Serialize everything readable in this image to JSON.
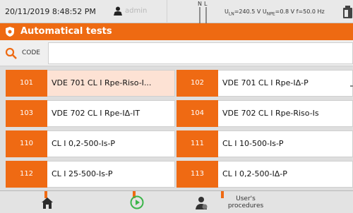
{
  "status": {
    "datetime": "20/11/2019 8:48:52 PM",
    "user": "admin",
    "n_label": "N",
    "l_label": "L",
    "uln_label": "U",
    "uln_sub": "LN",
    "uln_value": "=240.5 V",
    "upe_label": "U",
    "upe_sub": "NPE",
    "upe_value": "=0.8 V",
    "freq": "f=50.0 Hz"
  },
  "header": {
    "title": "Automatical tests"
  },
  "search": {
    "label": "CODE",
    "value": ""
  },
  "procedures": [
    {
      "num": "101",
      "name": "VDE 701 CL I Rpe-Riso-I...",
      "selected": true
    },
    {
      "num": "102",
      "name": "VDE 701 CL I Rpe-IΔ-P"
    },
    {
      "num": "103",
      "name": "VDE 702 CL I Rpe-IΔ-IT"
    },
    {
      "num": "104",
      "name": "VDE 702 CL I Rpe-Riso-Is"
    },
    {
      "num": "110",
      "name": "CL I 0,2-500-Is-P"
    },
    {
      "num": "111",
      "name": "CL I 10-500-Is-P"
    },
    {
      "num": "112",
      "name": "CL I 25-500-Is-P"
    },
    {
      "num": "113",
      "name": "CL I 0,2-500-IΔ-P"
    }
  ],
  "footer": {
    "user_procedures_line1": "User's",
    "user_procedures_line2": "procedures"
  },
  "colors": {
    "accent": "#ee6a12",
    "selected": "#fde2d4",
    "play": "#3bb54a"
  },
  "icons": [
    "user-icon",
    "battery-icon",
    "shield-icon",
    "search-icon",
    "home-icon",
    "play-icon",
    "user-procedures-icon"
  ]
}
